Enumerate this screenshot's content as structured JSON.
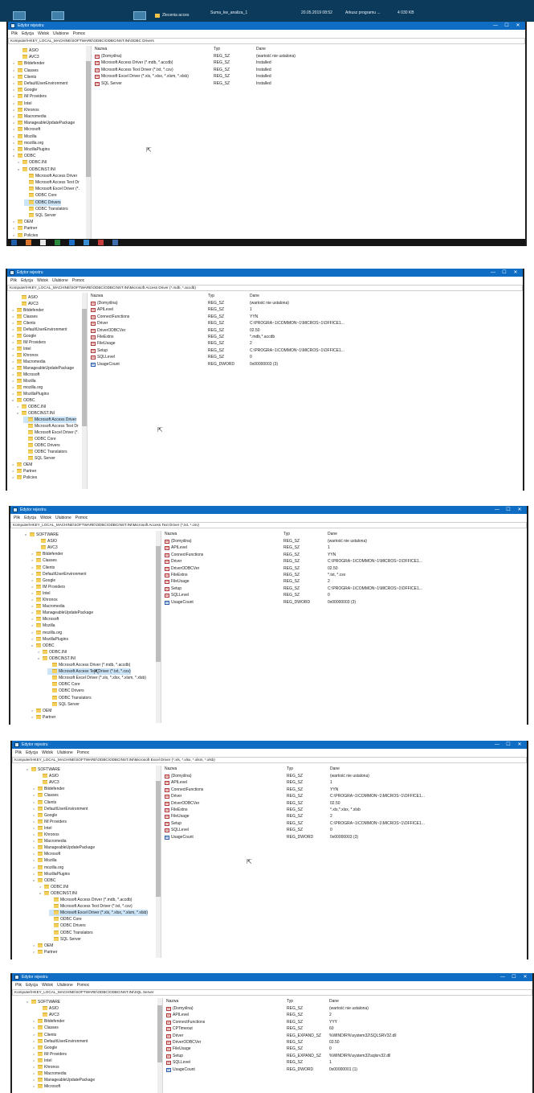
{
  "app": {
    "title": "Edytor rejestru",
    "menu": [
      "Plik",
      "Edycja",
      "Widok",
      "Ulubione",
      "Pomoc"
    ],
    "win_controls": [
      "—",
      "☐",
      "✕"
    ]
  },
  "columns": {
    "name": "Nazwa",
    "type": "Typ",
    "data": "Dane"
  },
  "desktop": {
    "items": [
      "Zlecenia acces",
      "Suma_kw_analiza_1",
      "20.05.2019 08:52",
      "Arkusz programu ...",
      "4 030 KB"
    ]
  },
  "colors": {
    "titlebar": "#0f6dc4",
    "selection": "#cce4f7",
    "folder": "#f5cf5b",
    "desktop": "#0b3a5a"
  },
  "screens": [
    {
      "address": "Komputer\\HKEY_LOCAL_MACHINE\\SOFTWARE\\ODBC\\ODBCINST.INI\\ODBC Drivers",
      "tree": [
        {
          "label": "ASIO",
          "chev": ""
        },
        {
          "label": "AVC3",
          "chev": ""
        },
        {
          "label": "Bitdefender",
          "chev": ">"
        },
        {
          "label": "Classes",
          "chev": ">"
        },
        {
          "label": "Clients",
          "chev": ">"
        },
        {
          "label": "DefaultUserEnvironment",
          "chev": ">"
        },
        {
          "label": "Google",
          "chev": ">"
        },
        {
          "label": "IM Providers",
          "chev": ">"
        },
        {
          "label": "Intel",
          "chev": ">"
        },
        {
          "label": "Khronos",
          "chev": ">"
        },
        {
          "label": "Macromedia",
          "chev": ">"
        },
        {
          "label": "ManageableUpdatePackage",
          "chev": ">"
        },
        {
          "label": "Microsoft",
          "chev": ">"
        },
        {
          "label": "Mozilla",
          "chev": ">"
        },
        {
          "label": "mozilla.org",
          "chev": ">"
        },
        {
          "label": "MozillaPlugins",
          "chev": ">"
        },
        {
          "label": "ODBC",
          "chev": "v"
        },
        {
          "label": "ODBC.INI",
          "chev": ">"
        },
        {
          "label": "ODBCINST.INI",
          "chev": "v"
        },
        {
          "label": "Microsoft Access Driver",
          "chev": ""
        },
        {
          "label": "Microsoft Access Text Dr",
          "chev": ""
        },
        {
          "label": "Microsoft Excel Driver (*.",
          "chev": ""
        },
        {
          "label": "ODBC Core",
          "chev": ""
        },
        {
          "label": "ODBC Drivers",
          "chev": "",
          "selected": true
        },
        {
          "label": "ODBC Translators",
          "chev": ""
        },
        {
          "label": "SQL Server",
          "chev": ""
        },
        {
          "label": "OEM",
          "chev": ">"
        },
        {
          "label": "Partner",
          "chev": ">"
        },
        {
          "label": "Policies",
          "chev": ">"
        }
      ],
      "values": [
        {
          "name": "(Domyślna)",
          "type": "REG_SZ",
          "data": "(wartość nie ustalona)",
          "kind": "sz"
        },
        {
          "name": "Microsoft Access Driver (*.mdb, *.accdb)",
          "type": "REG_SZ",
          "data": "Installed",
          "kind": "sz"
        },
        {
          "name": "Microsoft Access Text Driver (*.txt, *.csv)",
          "type": "REG_SZ",
          "data": "Installed",
          "kind": "sz"
        },
        {
          "name": "Microsoft Excel Driver (*.xls, *.xlsx, *.xlsm, *.xlsb)",
          "type": "REG_SZ",
          "data": "Installed",
          "kind": "sz"
        },
        {
          "name": "SQL Server",
          "type": "REG_SZ",
          "data": "Installed",
          "kind": "sz"
        }
      ]
    },
    {
      "address": "Komputer\\HKEY_LOCAL_MACHINE\\SOFTWARE\\ODBC\\ODBCINST.INI\\Microsoft Access Driver (*.mdb, *.accdb)",
      "tree": [
        {
          "label": "ASIO",
          "chev": ""
        },
        {
          "label": "AVC3",
          "chev": ""
        },
        {
          "label": "Bitdefender",
          "chev": ">"
        },
        {
          "label": "Classes",
          "chev": ">"
        },
        {
          "label": "Clients",
          "chev": ">"
        },
        {
          "label": "DefaultUserEnvironment",
          "chev": ">"
        },
        {
          "label": "Google",
          "chev": ">"
        },
        {
          "label": "IM Providers",
          "chev": ">"
        },
        {
          "label": "Intel",
          "chev": ">"
        },
        {
          "label": "Khronos",
          "chev": ">"
        },
        {
          "label": "Macromedia",
          "chev": ">"
        },
        {
          "label": "ManageableUpdatePackage",
          "chev": ">"
        },
        {
          "label": "Microsoft",
          "chev": ">"
        },
        {
          "label": "Mozilla",
          "chev": ">"
        },
        {
          "label": "mozilla.org",
          "chev": ">"
        },
        {
          "label": "MozillaPlugins",
          "chev": ">"
        },
        {
          "label": "ODBC",
          "chev": "v"
        },
        {
          "label": "ODBC.INI",
          "chev": ">"
        },
        {
          "label": "ODBCINST.INI",
          "chev": "v"
        },
        {
          "label": "Microsoft Access Driver",
          "chev": "",
          "selected": true
        },
        {
          "label": "Microsoft Access Text Dr",
          "chev": ""
        },
        {
          "label": "Microsoft Excel Driver (*.",
          "chev": ""
        },
        {
          "label": "ODBC Core",
          "chev": ""
        },
        {
          "label": "ODBC Drivers",
          "chev": ""
        },
        {
          "label": "ODBC Translators",
          "chev": ""
        },
        {
          "label": "SQL Server",
          "chev": ""
        },
        {
          "label": "OEM",
          "chev": ">"
        },
        {
          "label": "Partner",
          "chev": ">"
        },
        {
          "label": "Policies",
          "chev": ">"
        }
      ],
      "values": [
        {
          "name": "(Domyślna)",
          "type": "REG_SZ",
          "data": "(wartość nie ustalona)",
          "kind": "sz"
        },
        {
          "name": "APILevel",
          "type": "REG_SZ",
          "data": "1",
          "kind": "sz"
        },
        {
          "name": "ConnectFunctions",
          "type": "REG_SZ",
          "data": "YYN",
          "kind": "sz"
        },
        {
          "name": "Driver",
          "type": "REG_SZ",
          "data": "C:\\PROGRA~1\\COMMON~1\\MICROS~1\\OFFICE1...",
          "kind": "sz"
        },
        {
          "name": "DriverODBCVer",
          "type": "REG_SZ",
          "data": "02.50",
          "kind": "sz"
        },
        {
          "name": "FileExtns",
          "type": "REG_SZ",
          "data": "*.mdb,*.accdb",
          "kind": "sz"
        },
        {
          "name": "FileUsage",
          "type": "REG_SZ",
          "data": "2",
          "kind": "sz"
        },
        {
          "name": "Setup",
          "type": "REG_SZ",
          "data": "C:\\PROGRA~1\\COMMON~1\\MICROS~1\\OFFICE1...",
          "kind": "sz"
        },
        {
          "name": "SQLLevel",
          "type": "REG_SZ",
          "data": "0",
          "kind": "sz"
        },
        {
          "name": "UsageCount",
          "type": "REG_DWORD",
          "data": "0x00000003 (3)",
          "kind": "dw"
        }
      ]
    },
    {
      "address": "Komputer\\HKEY_LOCAL_MACHINE\\SOFTWARE\\ODBC\\ODBCINST.INI\\Microsoft Access Text Driver (*.txt, *.csv)",
      "tree": [
        {
          "label": "SOFTWARE",
          "chev": "v"
        },
        {
          "label": "ASIO",
          "chev": ""
        },
        {
          "label": "AVC3",
          "chev": ""
        },
        {
          "label": "Bitdefender",
          "chev": ">"
        },
        {
          "label": "Classes",
          "chev": ">"
        },
        {
          "label": "Clients",
          "chev": ">"
        },
        {
          "label": "DefaultUserEnvironment",
          "chev": ">"
        },
        {
          "label": "Google",
          "chev": ">"
        },
        {
          "label": "IM Providers",
          "chev": ">"
        },
        {
          "label": "Intel",
          "chev": ">"
        },
        {
          "label": "Khronos",
          "chev": ">"
        },
        {
          "label": "Macromedia",
          "chev": ">"
        },
        {
          "label": "ManageableUpdatePackage",
          "chev": ">"
        },
        {
          "label": "Microsoft",
          "chev": ">"
        },
        {
          "label": "Mozilla",
          "chev": ">"
        },
        {
          "label": "mozilla.org",
          "chev": ">"
        },
        {
          "label": "MozillaPlugins",
          "chev": ">"
        },
        {
          "label": "ODBC",
          "chev": "v"
        },
        {
          "label": "ODBC.INI",
          "chev": ">"
        },
        {
          "label": "ODBCINST.INI",
          "chev": "v"
        },
        {
          "label": "Microsoft Access Driver (*.mdb, *.accdb)",
          "chev": ""
        },
        {
          "label": "Microsoft Access Text Driver (*.txt, *.csv)",
          "chev": "",
          "selected": true
        },
        {
          "label": "Microsoft Excel Driver (*.xls, *.xlsx, *.xlsm, *.xlsb)",
          "chev": ""
        },
        {
          "label": "ODBC Core",
          "chev": ""
        },
        {
          "label": "ODBC Drivers",
          "chev": ""
        },
        {
          "label": "ODBC Translators",
          "chev": ""
        },
        {
          "label": "SQL Server",
          "chev": ""
        },
        {
          "label": "OEM",
          "chev": ">"
        },
        {
          "label": "Partner",
          "chev": ">"
        }
      ],
      "values": [
        {
          "name": "(Domyślna)",
          "type": "REG_SZ",
          "data": "(wartość nie ustalona)",
          "kind": "sz"
        },
        {
          "name": "APILevel",
          "type": "REG_SZ",
          "data": "1",
          "kind": "sz"
        },
        {
          "name": "ConnectFunctions",
          "type": "REG_SZ",
          "data": "YYN",
          "kind": "sz"
        },
        {
          "name": "Driver",
          "type": "REG_SZ",
          "data": "C:\\PROGRA~1\\COMMON~1\\MICROS~1\\OFFICE1...",
          "kind": "sz"
        },
        {
          "name": "DriverODBCVer",
          "type": "REG_SZ",
          "data": "02.50",
          "kind": "sz"
        },
        {
          "name": "FileExtns",
          "type": "REG_SZ",
          "data": "*.txt, *.csv",
          "kind": "sz"
        },
        {
          "name": "FileUsage",
          "type": "REG_SZ",
          "data": "2",
          "kind": "sz"
        },
        {
          "name": "Setup",
          "type": "REG_SZ",
          "data": "C:\\PROGRA~1\\COMMON~1\\MICROS~1\\OFFICE1...",
          "kind": "sz"
        },
        {
          "name": "SQLLevel",
          "type": "REG_SZ",
          "data": "0",
          "kind": "sz"
        },
        {
          "name": "UsageCount",
          "type": "REG_DWORD",
          "data": "0x00000003 (3)",
          "kind": "dw"
        }
      ]
    },
    {
      "address": "Komputer\\HKEY_LOCAL_MACHINE\\SOFTWARE\\ODBC\\ODBCINST.INI\\Microsoft Excel Driver (*.xls, *.xlsx, *.xlsm, *.xlsb)",
      "tree": [
        {
          "label": "SOFTWARE",
          "chev": "v"
        },
        {
          "label": "ASIO",
          "chev": ""
        },
        {
          "label": "AVC3",
          "chev": ""
        },
        {
          "label": "Bitdefender",
          "chev": ">"
        },
        {
          "label": "Classes",
          "chev": ">"
        },
        {
          "label": "Clients",
          "chev": ">"
        },
        {
          "label": "DefaultUserEnvironment",
          "chev": ">"
        },
        {
          "label": "Google",
          "chev": ">"
        },
        {
          "label": "IM Providers",
          "chev": ">"
        },
        {
          "label": "Intel",
          "chev": ">"
        },
        {
          "label": "Khronos",
          "chev": ">"
        },
        {
          "label": "Macromedia",
          "chev": ">"
        },
        {
          "label": "ManageableUpdatePackage",
          "chev": ">"
        },
        {
          "label": "Microsoft",
          "chev": ">"
        },
        {
          "label": "Mozilla",
          "chev": ">"
        },
        {
          "label": "mozilla.org",
          "chev": ">"
        },
        {
          "label": "MozillaPlugins",
          "chev": ">"
        },
        {
          "label": "ODBC",
          "chev": "v"
        },
        {
          "label": "ODBC.INI",
          "chev": ">"
        },
        {
          "label": "ODBCINST.INI",
          "chev": "v"
        },
        {
          "label": "Microsoft Access Driver (*.mdb, *.accdb)",
          "chev": ""
        },
        {
          "label": "Microsoft Access Text Driver (*.txt, *.csv)",
          "chev": ""
        },
        {
          "label": "Microsoft Excel Driver (*.xls, *.xlsx, *.xlsm, *.xlsb)",
          "chev": "",
          "selected": true
        },
        {
          "label": "ODBC Core",
          "chev": ""
        },
        {
          "label": "ODBC Drivers",
          "chev": ""
        },
        {
          "label": "ODBC Translators",
          "chev": ""
        },
        {
          "label": "SQL Server",
          "chev": ""
        },
        {
          "label": "OEM",
          "chev": ">"
        },
        {
          "label": "Partner",
          "chev": ">"
        }
      ],
      "values": [
        {
          "name": "(Domyślna)",
          "type": "REG_SZ",
          "data": "(wartość nie ustalona)",
          "kind": "sz"
        },
        {
          "name": "APILevel",
          "type": "REG_SZ",
          "data": "1",
          "kind": "sz"
        },
        {
          "name": "ConnectFunctions",
          "type": "REG_SZ",
          "data": "YYN",
          "kind": "sz"
        },
        {
          "name": "Driver",
          "type": "REG_SZ",
          "data": "C:\\PROGRA~1\\COMMON~1\\MICROS~1\\OFFICE1...",
          "kind": "sz"
        },
        {
          "name": "DriverODBCVer",
          "type": "REG_SZ",
          "data": "02.50",
          "kind": "sz"
        },
        {
          "name": "FileExtns",
          "type": "REG_SZ",
          "data": "*.xls,*.xlsx, *.xlsb",
          "kind": "sz"
        },
        {
          "name": "FileUsage",
          "type": "REG_SZ",
          "data": "2",
          "kind": "sz"
        },
        {
          "name": "Setup",
          "type": "REG_SZ",
          "data": "C:\\PROGRA~1\\COMMON~1\\MICROS~1\\OFFICE1...",
          "kind": "sz"
        },
        {
          "name": "SQLLevel",
          "type": "REG_SZ",
          "data": "0",
          "kind": "sz"
        },
        {
          "name": "UsageCount",
          "type": "REG_DWORD",
          "data": "0x00000003 (3)",
          "kind": "dw"
        }
      ]
    },
    {
      "address": "Komputer\\HKEY_LOCAL_MACHINE\\SOFTWARE\\ODBC\\ODBCINST.INI\\SQL Server",
      "tree": [
        {
          "label": "SOFTWARE",
          "chev": "v"
        },
        {
          "label": "ASIO",
          "chev": ""
        },
        {
          "label": "AVC3",
          "chev": ""
        },
        {
          "label": "Bitdefender",
          "chev": ">"
        },
        {
          "label": "Classes",
          "chev": ">"
        },
        {
          "label": "Clients",
          "chev": ">"
        },
        {
          "label": "DefaultUserEnvironment",
          "chev": ">"
        },
        {
          "label": "Google",
          "chev": ">"
        },
        {
          "label": "IM Providers",
          "chev": ">"
        },
        {
          "label": "Intel",
          "chev": ">"
        },
        {
          "label": "Khronos",
          "chev": ">"
        },
        {
          "label": "Macromedia",
          "chev": ">"
        },
        {
          "label": "ManageableUpdatePackage",
          "chev": ">"
        },
        {
          "label": "Microsoft",
          "chev": ">"
        }
      ],
      "values": [
        {
          "name": "(Domyślna)",
          "type": "REG_SZ",
          "data": "(wartość nie ustalona)",
          "kind": "sz"
        },
        {
          "name": "APILevel",
          "type": "REG_SZ",
          "data": "2",
          "kind": "sz"
        },
        {
          "name": "ConnectFunctions",
          "type": "REG_SZ",
          "data": "YYY",
          "kind": "sz"
        },
        {
          "name": "CPTimeout",
          "type": "REG_SZ",
          "data": "60",
          "kind": "sz"
        },
        {
          "name": "Driver",
          "type": "REG_EXPAND_SZ",
          "data": "%WINDIR%\\system32\\SQLSRV32.dll",
          "kind": "sz"
        },
        {
          "name": "DriverODBCVer",
          "type": "REG_SZ",
          "data": "03.50",
          "kind": "sz"
        },
        {
          "name": "FileUsage",
          "type": "REG_SZ",
          "data": "0",
          "kind": "sz"
        },
        {
          "name": "Setup",
          "type": "REG_EXPAND_SZ",
          "data": "%WINDIR%\\system32\\sqlsrv32.dll",
          "kind": "sz"
        },
        {
          "name": "SQLLevel",
          "type": "REG_SZ",
          "data": "1",
          "kind": "sz"
        },
        {
          "name": "UsageCount",
          "type": "REG_DWORD",
          "data": "0x00000001 (1)",
          "kind": "dw"
        }
      ]
    }
  ]
}
